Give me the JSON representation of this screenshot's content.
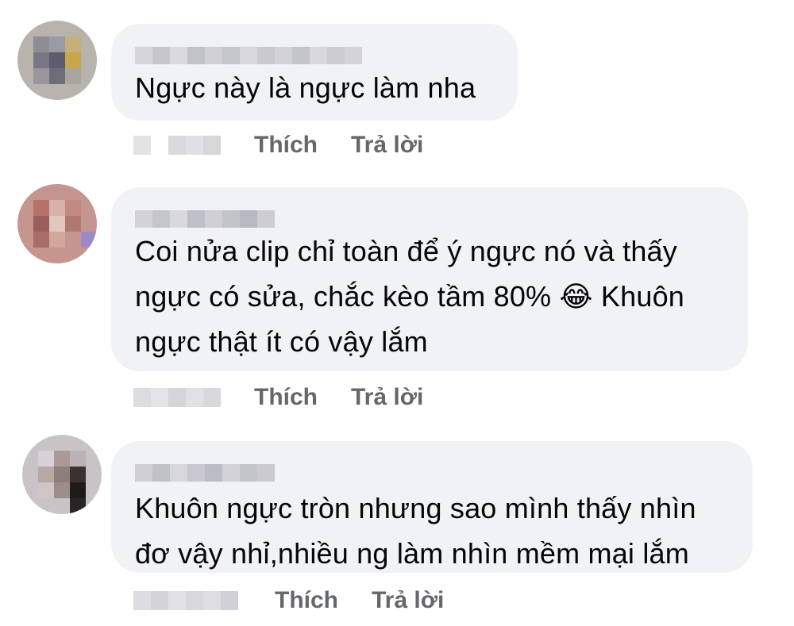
{
  "comments": [
    {
      "text": "Ngực này là ngực làm nha",
      "like_label": "Thích",
      "reply_label": "Trả lời"
    },
    {
      "text": "Coi nửa clip chỉ toàn để ý ngực nó và thấy\nngực có sửa, chắc kèo tầm 80% 😂 Khuôn\nngực thật ít có vậy lắm",
      "like_label": "Thích",
      "reply_label": "Trả lời"
    },
    {
      "text": "Khuôn ngực tròn nhưng sao mình thấy nhìn\nđơ vậy nhỉ,nhiều ng làm nhìn mềm mại lắm",
      "like_label": "Thích",
      "reply_label": "Trả lời"
    }
  ],
  "colors": {
    "bubble_bg": "#f0f2f5",
    "action_text": "#65676b",
    "comment_text": "#050505"
  }
}
